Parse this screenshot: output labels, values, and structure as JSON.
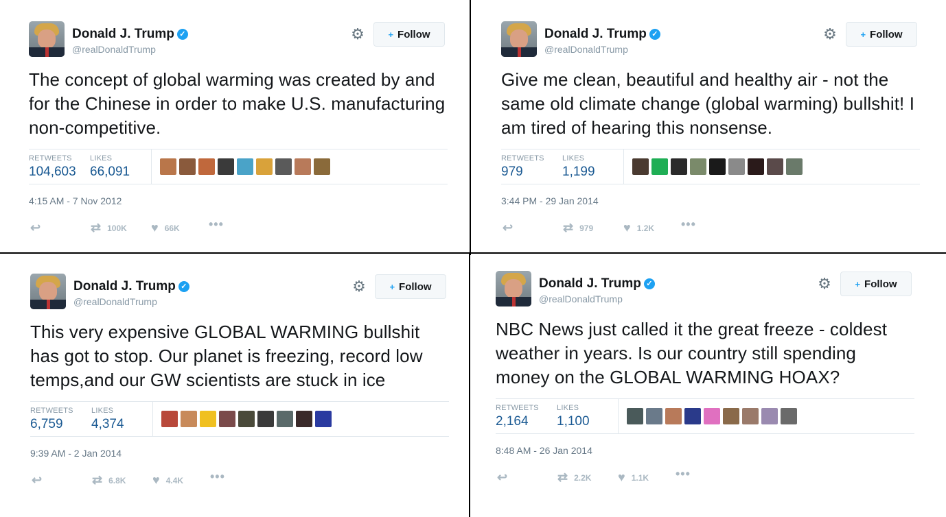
{
  "tweets": [
    {
      "name": "Donald J. Trump",
      "handle": "@realDonaldTrump",
      "follow_label": "Follow",
      "text": "The concept of global warming was created by and for the Chinese in order to make U.S. manufacturing non-competitive.",
      "retweets_label": "RETWEETS",
      "retweets": "104,603",
      "likes_label": "LIKES",
      "likes": "66,091",
      "timestamp": "4:15 AM - 7 Nov 2012",
      "retweet_count_short": "100K",
      "like_count_short": "66K",
      "liker_colors": [
        "#b9764a",
        "#8a5a3c",
        "#c0683c",
        "#3a3a3a",
        "#4aa3c8",
        "#d9a23a",
        "#5a5a5a",
        "#b87a5a",
        "#8a6a3a"
      ]
    },
    {
      "name": "Donald J. Trump",
      "handle": "@realDonaldTrump",
      "follow_label": "Follow",
      "text": "Give me clean, beautiful and healthy air - not the same old climate change (global warming) bullshit! I am tired of hearing this nonsense.",
      "retweets_label": "RETWEETS",
      "retweets": "979",
      "likes_label": "LIKES",
      "likes": "1,199",
      "timestamp": "3:44 PM - 29 Jan 2014",
      "retweet_count_short": "979",
      "like_count_short": "1.2K",
      "liker_colors": [
        "#4a3a30",
        "#1fae55",
        "#2a2a2a",
        "#7a8a6a",
        "#1a1a1a",
        "#8a8a8a",
        "#2a1a1a",
        "#5a4a4a",
        "#6a7a6a"
      ]
    },
    {
      "name": "Donald J. Trump",
      "handle": "@realDonaldTrump",
      "follow_label": "Follow",
      "text": "This very expensive GLOBAL WARMING bullshit has got to stop. Our planet is freezing, record low temps,and our GW scientists are stuck in ice",
      "retweets_label": "RETWEETS",
      "retweets": "6,759",
      "likes_label": "LIKES",
      "likes": "4,374",
      "timestamp": "9:39 AM - 2 Jan 2014",
      "retweet_count_short": "6.8K",
      "like_count_short": "4.4K",
      "liker_colors": [
        "#b8483a",
        "#c88a5a",
        "#f0c020",
        "#7a4a4a",
        "#4a4a3a",
        "#3a3a3a",
        "#5a6a6a",
        "#3a2a2a",
        "#2a3aa0"
      ]
    },
    {
      "name": "Donald J. Trump",
      "handle": "@realDonaldTrump",
      "follow_label": "Follow",
      "text": "NBC News just called it the great freeze - coldest weather in years. Is our country still spending money on the GLOBAL WARMING HOAX?",
      "retweets_label": "RETWEETS",
      "retweets": "2,164",
      "likes_label": "LIKES",
      "likes": "1,100",
      "timestamp": "8:48 AM - 26 Jan 2014",
      "retweet_count_short": "2.2K",
      "like_count_short": "1.1K",
      "liker_colors": [
        "#4a5a5a",
        "#6a7a8a",
        "#b87a5a",
        "#2a3a8a",
        "#e070c0",
        "#8a6a4a",
        "#9a7a6a",
        "#9a8ab0",
        "#6a6a6a"
      ]
    }
  ],
  "icons": {
    "verified": "✓",
    "gear": "⚙",
    "follow": "+",
    "reply": "↩",
    "retweet": "⇄",
    "like": "♥",
    "more": "•••"
  }
}
